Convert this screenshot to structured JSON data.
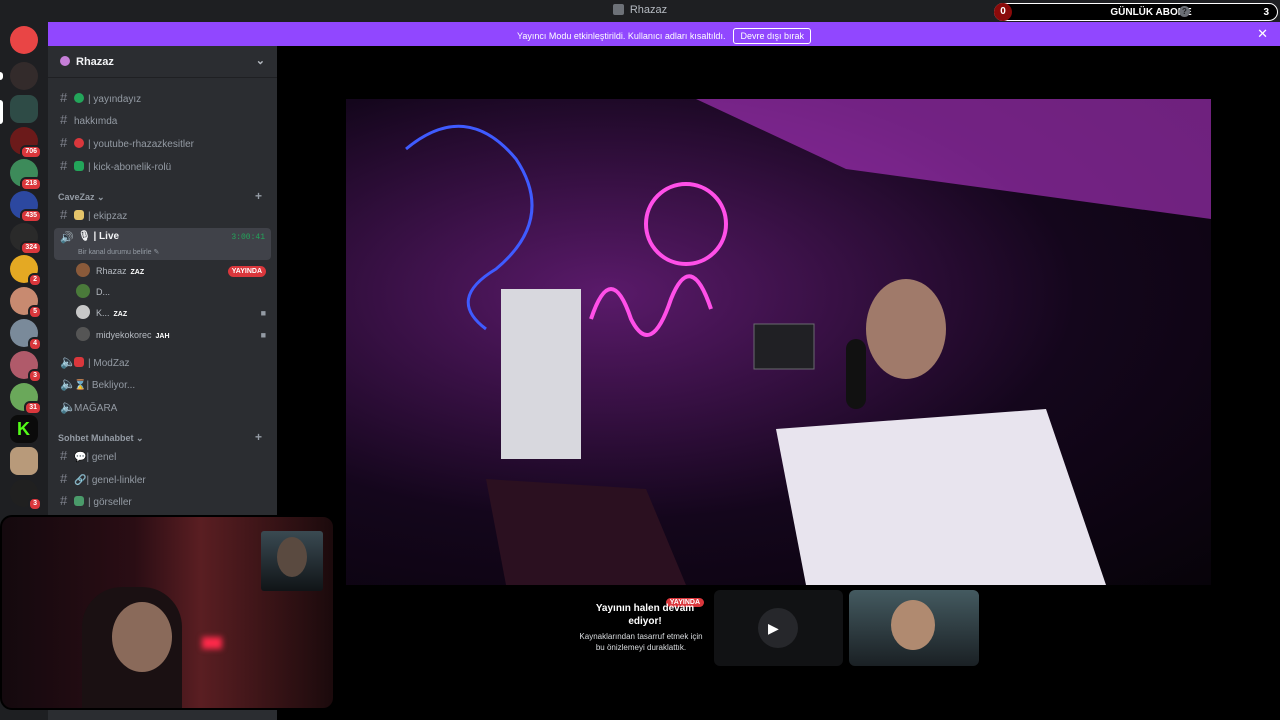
{
  "window": {
    "title": "Rhazaz"
  },
  "overlay": {
    "left_count": "0",
    "label": "GÜNLÜK ABONE",
    "right_count": "3"
  },
  "banner": {
    "message": "Yayıncı Modu etkinleştirildi. Kullanıcı adları kısaltıldı.",
    "button": "Devre dışı bırak"
  },
  "server": {
    "name": "Rhazaz"
  },
  "server_badges": [
    "706",
    "218",
    "435",
    "324",
    "2",
    "5",
    "4",
    "3",
    "31",
    "3"
  ],
  "channels_top": [
    {
      "name": "| yayındayız",
      "color": "#23a55a"
    },
    {
      "name": "hakkımda",
      "color": ""
    },
    {
      "name": "| youtube-rhazazkesitler",
      "color": "#da373c"
    },
    {
      "name": "| kick-abonelik-rolü",
      "color": "#23a55a"
    }
  ],
  "categories": {
    "cavezaz": "CaveZaz",
    "sohbet": "Sohbet Muhabbet"
  },
  "cave_channels": {
    "ekipzaz": "| ekipzaz",
    "live": "| Live",
    "live_timer": "3:00:41",
    "live_status": "Bir kanal durumu belirle"
  },
  "voice_users": [
    {
      "name": "Rhazaz",
      "tag": "ZAZ",
      "live": "YAYINDA"
    },
    {
      "name": "D...",
      "tag": "",
      "live": ""
    },
    {
      "name": "K...",
      "tag": "ZAZ",
      "live": ""
    },
    {
      "name": "midyekokorec",
      "tag": "JAH",
      "live": ""
    }
  ],
  "voice_channels": [
    "| ModZaz",
    "| Bekliyor...",
    "MAĞARA"
  ],
  "sohbet_channels": [
    "| genel",
    "| genel-linkler",
    "| görseller"
  ],
  "paused_tile": {
    "badge": "YAYINDA",
    "title": "Yayının halen devam ediyor!",
    "body": "Kaynaklarından tasarruf etmek için bu önizlemeyi duraklattık."
  },
  "colors": {
    "accent": "#9147ff",
    "live": "#da373c",
    "bg": "#000000"
  }
}
